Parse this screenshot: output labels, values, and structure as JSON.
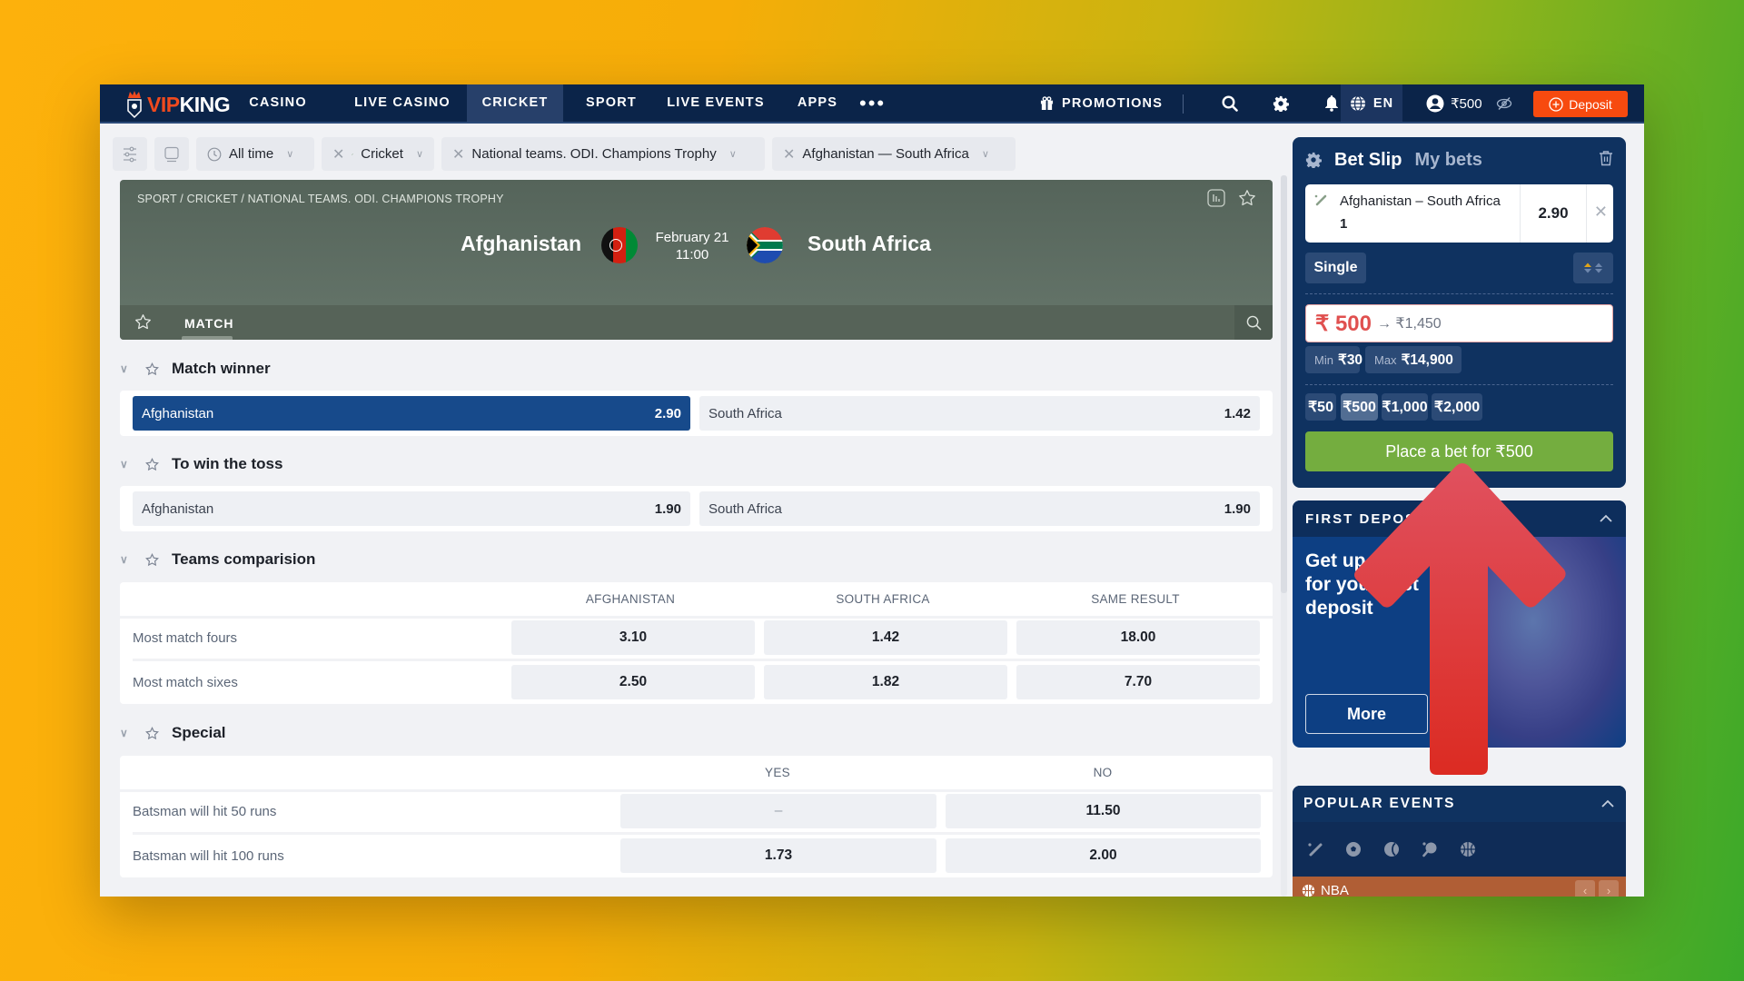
{
  "brand": {
    "part1": "VIP",
    "part2": "KING"
  },
  "nav": {
    "items": [
      "CASINO",
      "LIVE CASINO",
      "CRICKET",
      "SPORT",
      "LIVE EVENTS",
      "APPS"
    ],
    "active": "CRICKET",
    "more": "•••",
    "promotions": "PROMOTIONS",
    "language": "EN",
    "balance": "₹500",
    "deposit": "Deposit"
  },
  "filters": {
    "time": "All time",
    "sport": "Cricket",
    "league": "National teams. ODI. Champions Trophy",
    "event": "Afghanistan — South Africa"
  },
  "match": {
    "breadcrumb": "SPORT / CRICKET / NATIONAL TEAMS. ODI. CHAMPIONS TROPHY",
    "team_home": "Afghanistan",
    "team_away": "South Africa",
    "date": "February 21",
    "time": "11:00",
    "tab": "MATCH"
  },
  "markets": {
    "match_winner": {
      "title": "Match winner",
      "options": [
        {
          "label": "Afghanistan",
          "odd": "2.90",
          "selected": true
        },
        {
          "label": "South Africa",
          "odd": "1.42",
          "selected": false
        }
      ]
    },
    "toss": {
      "title": "To win the toss",
      "options": [
        {
          "label": "Afghanistan",
          "odd": "1.90"
        },
        {
          "label": "South Africa",
          "odd": "1.90"
        }
      ]
    },
    "comparison": {
      "title": "Teams comparision",
      "columns": [
        "AFGHANISTAN",
        "SOUTH AFRICA",
        "SAME RESULT"
      ],
      "rows": [
        {
          "label": "Most match fours",
          "values": [
            "3.10",
            "1.42",
            "18.00"
          ]
        },
        {
          "label": "Most match sixes",
          "values": [
            "2.50",
            "1.82",
            "7.70"
          ]
        }
      ]
    },
    "special": {
      "title": "Special",
      "columns": [
        "YES",
        "NO"
      ],
      "rows": [
        {
          "label": "Batsman will hit 50 runs",
          "values": [
            "–",
            "11.50"
          ]
        },
        {
          "label": "Batsman will hit 100 runs",
          "values": [
            "1.73",
            "2.00"
          ]
        }
      ]
    }
  },
  "betslip": {
    "title": "Bet Slip",
    "my_bets": "My bets",
    "selection": {
      "match": "Afghanistan – South Africa",
      "pick": "1",
      "odd": "2.90"
    },
    "type": "Single",
    "stake": "₹ 500",
    "potential_return": "→ ₹1,450",
    "min_label": "Min",
    "min_value": "₹30",
    "max_label": "Max",
    "max_value": "₹14,900",
    "quick_stakes": [
      "₹50",
      "₹500",
      "₹1,000",
      "₹2,000"
    ],
    "quick_selected": "₹500",
    "place_button": "Place a bet for ₹500"
  },
  "promo": {
    "title": "FIRST DEPOSIT",
    "text": "Get up to ₹... for your first deposit",
    "text_line1": "Get up",
    "text_line2": "for your first deposit",
    "more": "More"
  },
  "popular": {
    "title": "POPULAR EVENTS",
    "sports": [
      "cricket",
      "football",
      "tennis",
      "table-tennis",
      "basketball"
    ],
    "league": "NBA"
  },
  "colors": {
    "nav_bg": "#0b2449",
    "deposit": "#f74a0f",
    "selected_odd": "#174a8b",
    "place_bet": "#74ad3f",
    "stake_text": "#e0504f",
    "annotation_arrow": "#e0404a"
  }
}
